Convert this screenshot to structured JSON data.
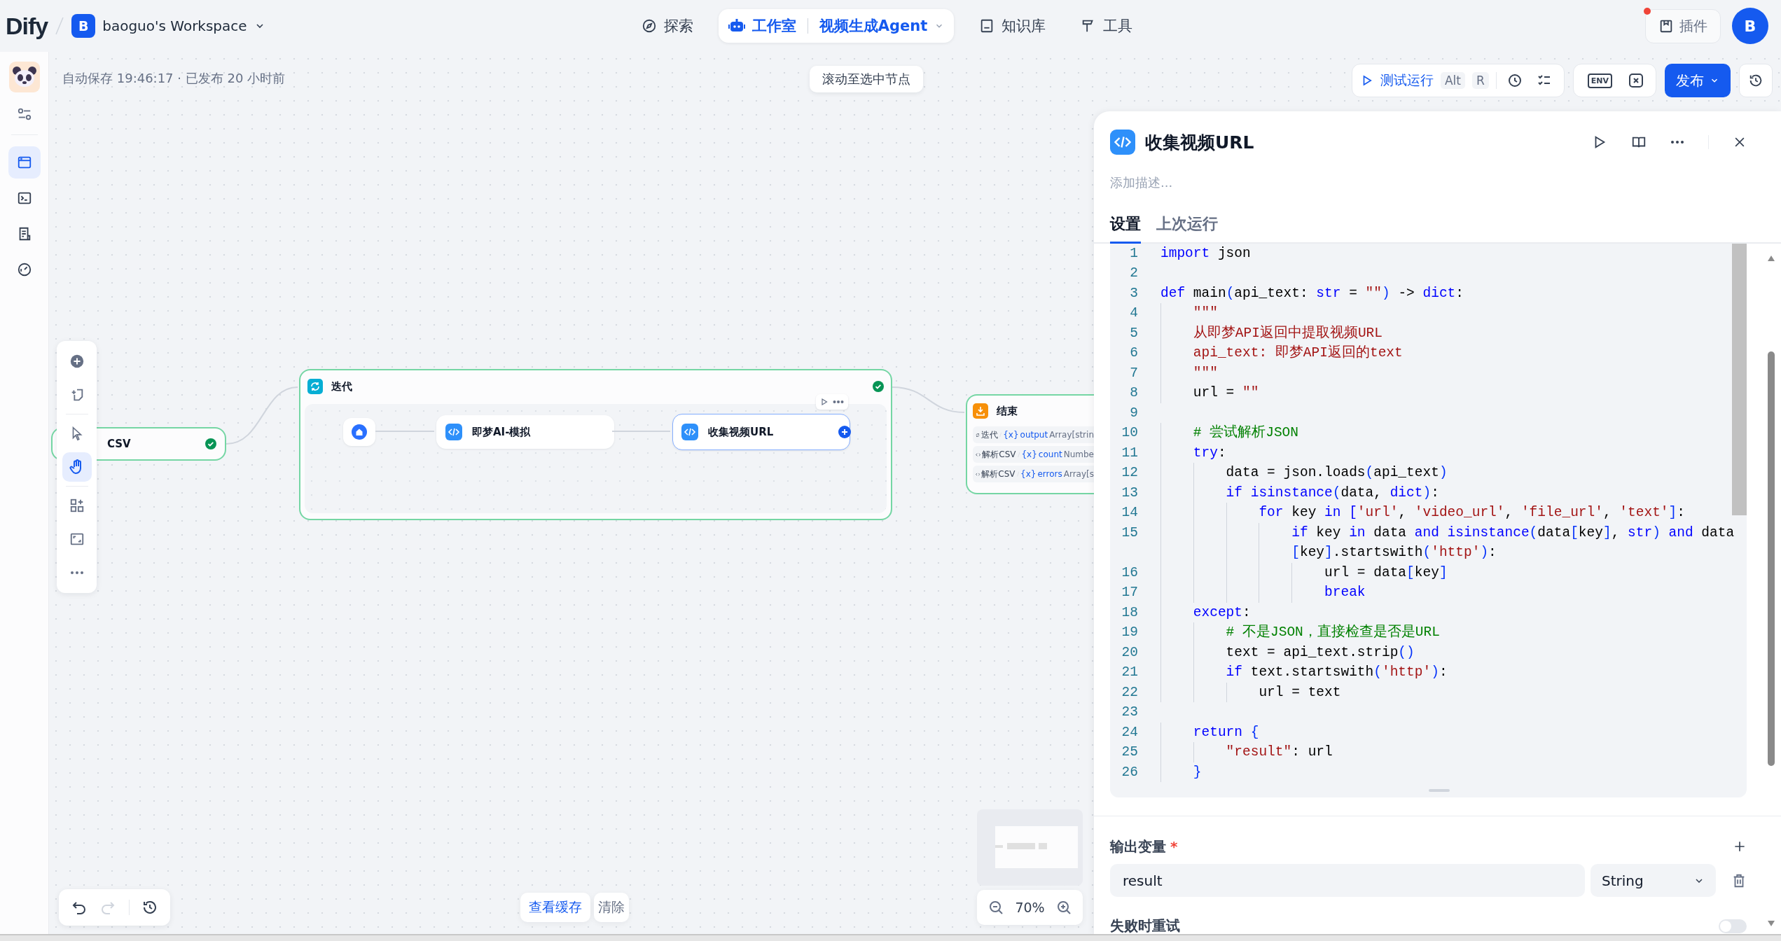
{
  "header": {
    "logo": "Dify",
    "workspace": {
      "initial": "B",
      "name": "baoguo's Workspace"
    },
    "nav": [
      {
        "kind": "explore",
        "label": "探索",
        "selected": false
      },
      {
        "kind": "studio",
        "label": "工作室",
        "selected": true,
        "app": "视频生成Agent"
      },
      {
        "kind": "knowledge",
        "label": "知识库",
        "selected": false
      },
      {
        "kind": "tools",
        "label": "工具",
        "selected": false
      }
    ],
    "plugins": {
      "label": "插件",
      "notification": true
    },
    "avatar": "B"
  },
  "sidebar": {
    "items": [
      {
        "kind": "orchestrate",
        "selected": true
      },
      {
        "kind": "api",
        "selected": false
      },
      {
        "kind": "logs",
        "selected": false
      },
      {
        "kind": "monitor",
        "selected": false
      }
    ]
  },
  "canvas": {
    "status": "自动保存 19:46:17 · 已发布 20 小时前",
    "scroll_button": "滚动至选中节点",
    "actions": {
      "run": "测试运行",
      "shortcut": [
        "Alt",
        "R"
      ],
      "env": "ENV",
      "publish": "发布"
    },
    "tools": [
      {
        "kind": "add",
        "selected": false
      },
      {
        "kind": "note",
        "selected": false
      },
      {
        "kind": "pointer",
        "selected": false
      },
      {
        "kind": "hand",
        "selected": true
      },
      {
        "kind": "organize",
        "selected": false
      },
      {
        "kind": "frame",
        "selected": false
      },
      {
        "kind": "more",
        "selected": false
      }
    ],
    "nodes": {
      "source": {
        "title": "CSV",
        "success": true
      },
      "iteration": {
        "title": "迭代",
        "success": true,
        "children": [
          {
            "kind": "start"
          },
          {
            "kind": "code",
            "title": "即梦AI-模拟",
            "selected": false
          },
          {
            "kind": "code",
            "title": "收集视频URL",
            "selected": true
          }
        ]
      },
      "end": {
        "title": "结束",
        "outputs": [
          {
            "kind": "iteration",
            "source": "迭代",
            "marker": "{x}",
            "variable": "output",
            "type": "Array[strin"
          },
          {
            "kind": "code",
            "source": "解析CSV",
            "marker": "{x}",
            "variable": "count",
            "type": "Numbe"
          },
          {
            "kind": "code",
            "source": "解析CSV",
            "marker": "{x}",
            "variable": "errors",
            "type": "Array[s"
          }
        ]
      }
    },
    "cache": {
      "view": "查看缓存",
      "clear": "清除"
    },
    "zoom": "70%"
  },
  "panel": {
    "title": "收集视频URL",
    "description_placeholder": "添加描述...",
    "tabs": [
      {
        "label": "设置",
        "selected": true
      },
      {
        "label": "上次运行",
        "selected": false
      }
    ],
    "code": [
      {
        "n": "1",
        "tokens": [
          {
            "kind": "keyword",
            "text": "import"
          },
          {
            "kind": "plain",
            "text": " json"
          }
        ]
      },
      {
        "n": "2"
      },
      {
        "n": "3",
        "tokens": [
          {
            "kind": "keyword",
            "text": "def"
          },
          {
            "kind": "plain",
            "text": " main"
          },
          {
            "kind": "bracket",
            "text": "("
          },
          {
            "kind": "plain",
            "text": "api_text: "
          },
          {
            "kind": "keyword",
            "text": "str"
          },
          {
            "kind": "plain",
            "text": " = "
          },
          {
            "kind": "string",
            "text": "\"\""
          },
          {
            "kind": "bracket",
            "text": ")"
          },
          {
            "kind": "plain",
            "text": " -> "
          },
          {
            "kind": "keyword",
            "text": "dict"
          },
          {
            "kind": "plain",
            "text": ":"
          }
        ]
      },
      {
        "n": "4",
        "tokens": [
          {
            "kind": "string",
            "text": "    \"\"\""
          }
        ]
      },
      {
        "n": "5",
        "tokens": [
          {
            "kind": "string",
            "text": "    从即梦API返回中提取视频URL"
          }
        ]
      },
      {
        "n": "6",
        "tokens": [
          {
            "kind": "string",
            "text": "    api_text: 即梦API返回的text"
          }
        ]
      },
      {
        "n": "7",
        "tokens": [
          {
            "kind": "string",
            "text": "    \"\"\""
          }
        ]
      },
      {
        "n": "8",
        "tokens": [
          {
            "kind": "plain",
            "text": "    url = "
          },
          {
            "kind": "string",
            "text": "\"\""
          }
        ]
      },
      {
        "n": "9"
      },
      {
        "n": "10",
        "tokens": [
          {
            "kind": "comment",
            "text": "    # 尝试解析JSON"
          }
        ]
      },
      {
        "n": "11",
        "tokens": [
          {
            "kind": "keyword",
            "text": "    try"
          },
          {
            "kind": "plain",
            "text": ":"
          }
        ]
      },
      {
        "n": "12",
        "tokens": [
          {
            "kind": "plain",
            "text": "        data = json.loads"
          },
          {
            "kind": "bracket",
            "text": "("
          },
          {
            "kind": "plain",
            "text": "api_text"
          },
          {
            "kind": "bracket",
            "text": ")"
          }
        ]
      },
      {
        "n": "13",
        "tokens": [
          {
            "kind": "keyword",
            "text": "        if isinstance"
          },
          {
            "kind": "bracket",
            "text": "("
          },
          {
            "kind": "plain",
            "text": "data, "
          },
          {
            "kind": "keyword",
            "text": "dict"
          },
          {
            "kind": "bracket",
            "text": ")"
          },
          {
            "kind": "plain",
            "text": ":"
          }
        ]
      },
      {
        "n": "14",
        "tokens": [
          {
            "kind": "keyword",
            "text": "            for"
          },
          {
            "kind": "plain",
            "text": " key "
          },
          {
            "kind": "keyword",
            "text": "in ["
          },
          {
            "kind": "string",
            "text": "'url'"
          },
          {
            "kind": "plain",
            "text": ", "
          },
          {
            "kind": "string",
            "text": "'video_url'"
          },
          {
            "kind": "plain",
            "text": ", "
          },
          {
            "kind": "string",
            "text": "'file_url'"
          },
          {
            "kind": "plain",
            "text": ", "
          },
          {
            "kind": "string",
            "text": "'text'"
          },
          {
            "kind": "bracket",
            "text": "]"
          },
          {
            "kind": "plain",
            "text": ":"
          }
        ]
      },
      {
        "n": "15",
        "tokens": [
          {
            "kind": "keyword",
            "text": "                if"
          },
          {
            "kind": "plain",
            "text": " key "
          },
          {
            "kind": "keyword",
            "text": "in"
          },
          {
            "kind": "plain",
            "text": " data "
          },
          {
            "kind": "keyword",
            "text": "and isinstance"
          },
          {
            "kind": "bracket",
            "text": "("
          },
          {
            "kind": "plain",
            "text": "data"
          },
          {
            "kind": "bracket",
            "text": "["
          },
          {
            "kind": "plain",
            "text": "key"
          },
          {
            "kind": "bracket",
            "text": "]"
          },
          {
            "kind": "plain",
            "text": ", "
          },
          {
            "kind": "keyword",
            "text": "str"
          },
          {
            "kind": "bracket",
            "text": ")"
          },
          {
            "kind": "keyword",
            "text": " and"
          },
          {
            "kind": "plain",
            "text": " data"
          }
        ]
      },
      {
        "tokens": [
          {
            "kind": "bracket",
            "text": "                ["
          },
          {
            "kind": "plain",
            "text": "key"
          },
          {
            "kind": "bracket",
            "text": "]"
          },
          {
            "kind": "plain",
            "text": ".startswith"
          },
          {
            "kind": "bracket",
            "text": "("
          },
          {
            "kind": "string",
            "text": "'http'"
          },
          {
            "kind": "bracket",
            "text": ")"
          },
          {
            "kind": "plain",
            "text": ":"
          }
        ]
      },
      {
        "n": "16",
        "tokens": [
          {
            "kind": "plain",
            "text": "                    url = data"
          },
          {
            "kind": "bracket",
            "text": "["
          },
          {
            "kind": "plain",
            "text": "key"
          },
          {
            "kind": "bracket",
            "text": "]"
          }
        ]
      },
      {
        "n": "17",
        "tokens": [
          {
            "kind": "keyword",
            "text": "                    break"
          }
        ]
      },
      {
        "n": "18",
        "tokens": [
          {
            "kind": "keyword",
            "text": "    except"
          },
          {
            "kind": "plain",
            "text": ":"
          }
        ]
      },
      {
        "n": "19",
        "tokens": [
          {
            "kind": "comment",
            "text": "        # 不是JSON，直接检查是否是URL"
          }
        ]
      },
      {
        "n": "20",
        "tokens": [
          {
            "kind": "plain",
            "text": "        text = api_text.strip"
          },
          {
            "kind": "bracket",
            "text": "()"
          }
        ]
      },
      {
        "n": "21",
        "tokens": [
          {
            "kind": "keyword",
            "text": "        if"
          },
          {
            "kind": "plain",
            "text": " text.startswith"
          },
          {
            "kind": "bracket",
            "text": "("
          },
          {
            "kind": "string",
            "text": "'http'"
          },
          {
            "kind": "bracket",
            "text": ")"
          },
          {
            "kind": "plain",
            "text": ":"
          }
        ]
      },
      {
        "n": "22",
        "tokens": [
          {
            "kind": "plain",
            "text": "            url = text"
          }
        ]
      },
      {
        "n": "23"
      },
      {
        "n": "24",
        "tokens": [
          {
            "kind": "keyword",
            "text": "    return"
          },
          {
            "kind": "bracket",
            "text": " {"
          }
        ]
      },
      {
        "n": "25",
        "tokens": [
          {
            "kind": "string",
            "text": "        \"result\""
          },
          {
            "kind": "plain",
            "text": ": url"
          }
        ]
      },
      {
        "n": "26",
        "tokens": [
          {
            "kind": "bracket",
            "text": "    }"
          }
        ]
      }
    ],
    "outputs": {
      "label": "输出变量",
      "required_mark": "*",
      "variables": [
        {
          "name": "result",
          "type": "String"
        }
      ]
    },
    "retry": {
      "label": "失败时重试",
      "on": false
    }
  }
}
